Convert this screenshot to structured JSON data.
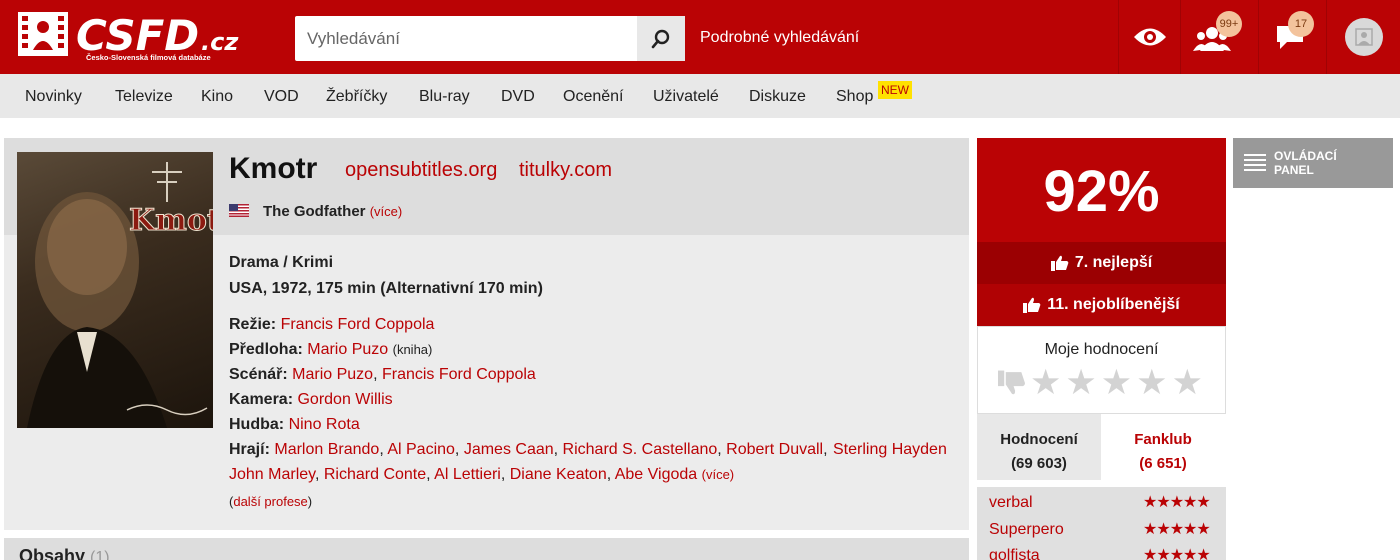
{
  "header": {
    "logo_text": "CSFD.cz",
    "logo_tagline": "Česko-Slovenská filmová databáze",
    "search_placeholder": "Vyhledávání",
    "advanced_search": "Podrobné vyhledávání",
    "friends_badge": "99+",
    "messages_badge": "17",
    "brand_color": "#ba0305"
  },
  "nav": {
    "items": [
      "Novinky",
      "Televize",
      "Kino",
      "VOD",
      "Žebříčky",
      "Blu-ray",
      "DVD",
      "Ocenění",
      "Uživatelé",
      "Diskuze",
      "Shop"
    ],
    "new_badge": "NEW"
  },
  "film": {
    "title": "Kmotr",
    "links": [
      "opensubtitles.org",
      "titulky.com"
    ],
    "original_title": "The Godfather",
    "original_more": "(více)",
    "genres": "Drama / Krimi",
    "origin": "USA, 1972, 175 min (Alternativní 170 min)",
    "credits": {
      "director_label": "Režie:",
      "director": "Francis Ford Coppola",
      "source_label": "Předloha:",
      "source": "Mario Puzo",
      "source_note": "(kniha)",
      "screenplay_label": "Scénář:",
      "screenplay_1": "Mario Puzo",
      "screenplay_2": "Francis Ford Coppola",
      "camera_label": "Kamera:",
      "camera": "Gordon Willis",
      "music_label": "Hudba:",
      "music": "Nino Rota",
      "cast_label": "Hrají:",
      "cast": [
        "Marlon Brando",
        "Al Pacino",
        "James Caan",
        "Richard S. Castellano",
        "Robert Duvall",
        "Sterling Hayden",
        "John Marley",
        "Richard Conte",
        "Al Lettieri",
        "Diane Keaton",
        "Abe Vigoda"
      ],
      "cast_more": "(více)",
      "more_professions": "další profese"
    },
    "content_section": "Obsahy",
    "content_count": "(1)"
  },
  "rating": {
    "value": "92%",
    "best_rank": "7. nejlepší",
    "favorite_rank": "11. nejoblíbenější",
    "my_rating_label": "Moje hodnocení",
    "my_rating_stars": 0,
    "tab_ratings_label": "Hodnocení",
    "tab_ratings_count": "(69 603)",
    "tab_fanclub_label": "Fanklub",
    "tab_fanclub_count": "(6 651)",
    "users": [
      {
        "name": "verbal",
        "stars": 5
      },
      {
        "name": "Superpero",
        "stars": 5
      },
      {
        "name": "golfista",
        "stars": 5
      }
    ]
  },
  "control_panel": {
    "label": "OVLÁDACÍ PANEL"
  }
}
